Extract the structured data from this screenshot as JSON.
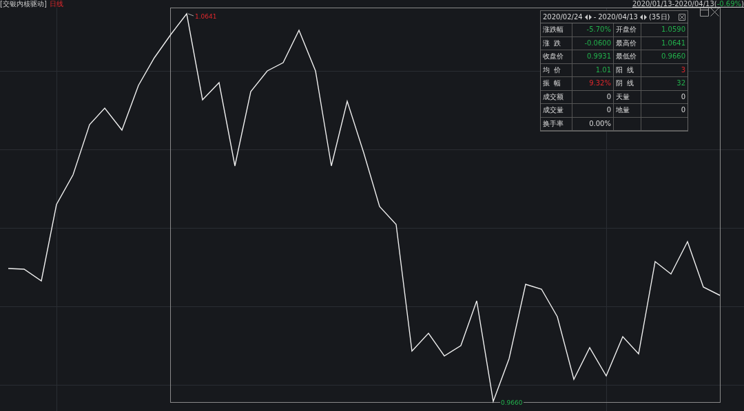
{
  "title": "[交银内核驱动]",
  "period": "日线",
  "range": {
    "dates": "2020/01/13-2020/04/13",
    "open_paren": "(",
    "change": "-0.69%",
    "close_paren": ")"
  },
  "chart": {
    "high_label": "1.0641",
    "low_label": "0.9660"
  },
  "stats_panel": {
    "start": "2020/02/24",
    "separator": "-",
    "end": "2020/04/13",
    "days": "(35日)",
    "rows": [
      [
        {
          "label": "涨跌幅",
          "value": "-5.70%",
          "color": "#22b14c"
        },
        {
          "label": "开盘价",
          "value": "1.0590",
          "color": "#22b14c"
        }
      ],
      [
        {
          "label": "涨  跌",
          "value": "-0.0600",
          "color": "#22b14c"
        },
        {
          "label": "最高价",
          "value": "1.0641",
          "color": "#22b14c"
        }
      ],
      [
        {
          "label": "收盘价",
          "value": "0.9931",
          "color": "#22b14c"
        },
        {
          "label": "最低价",
          "value": "0.9660",
          "color": "#22b14c"
        }
      ],
      [
        {
          "label": "均  价",
          "value": "1.01",
          "color": "#22b14c"
        },
        {
          "label": "阳  线",
          "value": "3",
          "color": "#e0272c"
        }
      ],
      [
        {
          "label": "振  幅",
          "value": "9.32%",
          "color": "#e0272c"
        },
        {
          "label": "阴  线",
          "value": "32",
          "color": "#22b14c"
        }
      ],
      [
        {
          "label": "成交额",
          "value": "0"
        },
        {
          "label": "天量",
          "value": "0"
        }
      ],
      [
        {
          "label": "成交量",
          "value": "0"
        },
        {
          "label": "地量",
          "value": "0"
        }
      ],
      [
        {
          "label": "换手率",
          "value": "0.00%"
        }
      ]
    ]
  }
}
